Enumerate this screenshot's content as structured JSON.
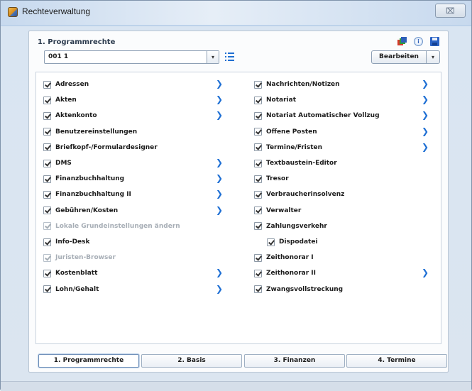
{
  "window": {
    "title": "Rechteverwaltung",
    "close_glyph": "⌧"
  },
  "panel": {
    "title": "1. Programmrechte",
    "icons": [
      "stacked-windows-icon",
      "info-icon",
      "save-icon"
    ],
    "info_glyph": "i"
  },
  "toolbar": {
    "select_value": "001 1",
    "select_arrow": "▾",
    "edit_label": "Bearbeiten",
    "edit_arrow": "▾"
  },
  "left_rights": [
    {
      "label": "Adressen",
      "checked": true,
      "enabled": true,
      "arrow": true
    },
    {
      "label": "Akten",
      "checked": true,
      "enabled": true,
      "arrow": true
    },
    {
      "label": "Aktenkonto",
      "checked": true,
      "enabled": true,
      "arrow": true
    },
    {
      "label": "Benutzereinstellungen",
      "checked": true,
      "enabled": true,
      "arrow": false
    },
    {
      "label": "Briefkopf-/Formulardesigner",
      "checked": true,
      "enabled": true,
      "arrow": false
    },
    {
      "label": "DMS",
      "checked": true,
      "enabled": true,
      "arrow": true
    },
    {
      "label": "Finanzbuchhaltung",
      "checked": true,
      "enabled": true,
      "arrow": true
    },
    {
      "label": "Finanzbuchhaltung II",
      "checked": true,
      "enabled": true,
      "arrow": true
    },
    {
      "label": "Gebühren/Kosten",
      "checked": true,
      "enabled": true,
      "arrow": true
    },
    {
      "label": "Lokale Grundeinstellungen ändern",
      "checked": true,
      "enabled": false,
      "arrow": false
    },
    {
      "label": "Info-Desk",
      "checked": true,
      "enabled": true,
      "arrow": false
    },
    {
      "label": "Juristen-Browser",
      "checked": true,
      "enabled": false,
      "arrow": false
    },
    {
      "label": "Kostenblatt",
      "checked": true,
      "enabled": true,
      "arrow": true
    },
    {
      "label": "Lohn/Gehalt",
      "checked": true,
      "enabled": true,
      "arrow": true
    }
  ],
  "right_rights": [
    {
      "label": "Nachrichten/Notizen",
      "checked": true,
      "enabled": true,
      "arrow": true,
      "indent": false
    },
    {
      "label": "Notariat",
      "checked": true,
      "enabled": true,
      "arrow": true,
      "indent": false
    },
    {
      "label": "Notariat Automatischer Vollzug",
      "checked": true,
      "enabled": true,
      "arrow": true,
      "indent": false
    },
    {
      "label": "Offene Posten",
      "checked": true,
      "enabled": true,
      "arrow": true,
      "indent": false
    },
    {
      "label": "Termine/Fristen",
      "checked": true,
      "enabled": true,
      "arrow": true,
      "indent": false
    },
    {
      "label": "Textbaustein-Editor",
      "checked": true,
      "enabled": true,
      "arrow": false,
      "indent": false
    },
    {
      "label": "Tresor",
      "checked": true,
      "enabled": true,
      "arrow": false,
      "indent": false
    },
    {
      "label": "Verbraucherinsolvenz",
      "checked": true,
      "enabled": true,
      "arrow": false,
      "indent": false
    },
    {
      "label": "Verwalter",
      "checked": true,
      "enabled": true,
      "arrow": false,
      "indent": false
    },
    {
      "label": "Zahlungsverkehr",
      "checked": true,
      "enabled": true,
      "arrow": false,
      "indent": false
    },
    {
      "label": "Dispodatei",
      "checked": true,
      "enabled": true,
      "arrow": false,
      "indent": true
    },
    {
      "label": "Zeithonorar I",
      "checked": true,
      "enabled": true,
      "arrow": false,
      "indent": false
    },
    {
      "label": "Zeithonorar II",
      "checked": true,
      "enabled": true,
      "arrow": true,
      "indent": false
    },
    {
      "label": "Zwangsvollstreckung",
      "checked": true,
      "enabled": true,
      "arrow": false,
      "indent": false
    }
  ],
  "arrow_glyph": "❯",
  "tabs": [
    {
      "label": "1. Programmrechte",
      "active": true
    },
    {
      "label": "2. Basis",
      "active": false
    },
    {
      "label": "3. Finanzen",
      "active": false
    },
    {
      "label": "4. Termine",
      "active": false
    }
  ]
}
